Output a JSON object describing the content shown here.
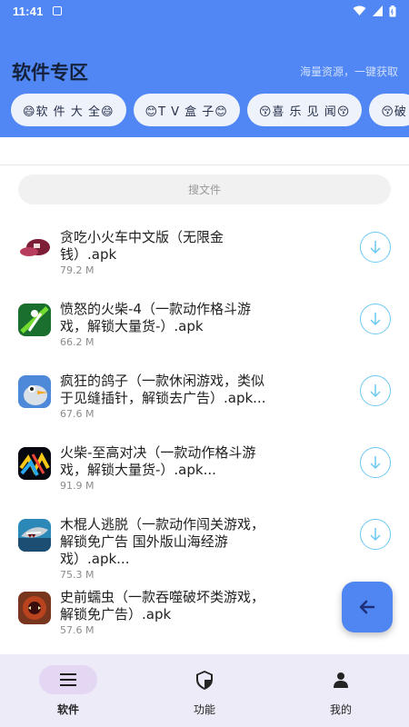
{
  "status": {
    "time": "11:41"
  },
  "header": {
    "title": "软件专区",
    "subtitle": "海量资源，一键获取"
  },
  "chips": [
    "😄软 件 大 全😄",
    "😊T V 盒 子😊",
    "😚喜 乐 见 闻😚",
    "😚破"
  ],
  "search": {
    "placeholder": "搜文件"
  },
  "files": [
    {
      "name": "贪吃小火车中文版（无限金钱）.apk",
      "size": "79.2 M",
      "icon": "train-game-icon"
    },
    {
      "name": "愤怒的火柴-4（一款动作格斗游戏，解锁大量货-）.apk",
      "size": "66.2 M",
      "icon": "stickman-game-icon"
    },
    {
      "name": "疯狂的鸽子（一款休闲游戏，类似于见缝插针，解锁去广告）.apk...",
      "size": "67.6 M",
      "icon": "pigeon-game-icon"
    },
    {
      "name": "火柴-至高对决（一款动作格斗游戏，解锁大量货-）.apk...",
      "size": "91.9 M",
      "icon": "stickman-duel-icon"
    },
    {
      "name": "木棍人逃脱（一款动作闯关游戏，解锁免广告 国外版山海经游戏）.apk...",
      "size": "75.3 M",
      "icon": "shark-game-icon"
    },
    {
      "name": "史前蠕虫（一款吞噬破坏类游戏，解锁免广告）.apk",
      "size": "57.6 M",
      "icon": "worm-game-icon"
    }
  ],
  "nav": [
    {
      "label": "软件",
      "icon": "menu-icon",
      "active": true
    },
    {
      "label": "功能",
      "icon": "shield-icon",
      "active": false
    },
    {
      "label": "我的",
      "icon": "person-icon",
      "active": false
    }
  ],
  "colors": {
    "header": "#5087f4",
    "accent": "#4f86f2",
    "download": "#6cc9f2",
    "bottom_nav": "#ecebf7"
  }
}
